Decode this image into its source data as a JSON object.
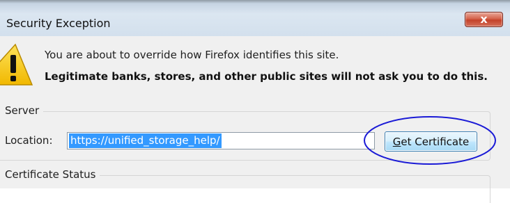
{
  "window": {
    "title": "Security Exception",
    "close_label": "x"
  },
  "message": {
    "line1": "You are about to override how Firefox identifies this site.",
    "line2": "Legitimate banks, stores, and other public sites will not ask you to do this."
  },
  "server": {
    "group_label": "Server",
    "location_label": "Location:",
    "location_value": "https://unified_storage_help/",
    "get_certificate_access_key": "G",
    "get_certificate_rest": "et Certificate"
  },
  "certificate_status": {
    "group_label": "Certificate Status"
  },
  "colors": {
    "accent_selection": "#3399ff",
    "annotation_ellipse": "#1a1ad6",
    "warning_yellow": "#f5c400"
  },
  "icons": {
    "warning": "warning-triangle-icon",
    "close": "close-icon"
  }
}
